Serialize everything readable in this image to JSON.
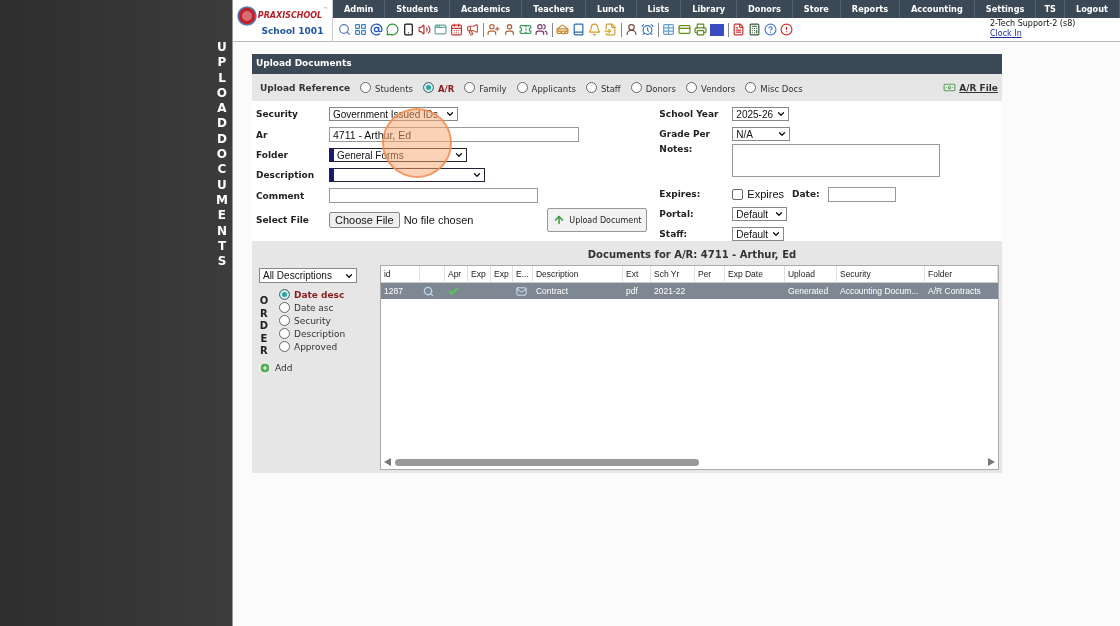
{
  "sidebar_title": "UPLOAD DOCUMENTS",
  "logo": {
    "brand": "PRAXISCHOOL",
    "trademark": "™",
    "school": "School 1001"
  },
  "nav": [
    "Admin",
    "Students",
    "Academics",
    "Teachers",
    "Lunch",
    "Lists",
    "Library",
    "Donors",
    "Store",
    "Reports",
    "Accounting",
    "Settings",
    "TS",
    "Logout"
  ],
  "user": {
    "name": "2-Tech Support-2 (s8)",
    "clock_link": "Clock In"
  },
  "panel": {
    "title": "Upload Documents",
    "reference_label": "Upload Reference",
    "references": [
      {
        "label": "Students",
        "selected": false
      },
      {
        "label": "A/R",
        "selected": true
      },
      {
        "label": "Family",
        "selected": false
      },
      {
        "label": "Applicants",
        "selected": false
      },
      {
        "label": "Staff",
        "selected": false
      },
      {
        "label": "Donors",
        "selected": false
      },
      {
        "label": "Vendors",
        "selected": false
      },
      {
        "label": "Misc Docs",
        "selected": false
      }
    ],
    "ar_file_link": "A/R File"
  },
  "left_fields": [
    {
      "kind": "select",
      "label": "Security",
      "value": "Government Issued IDs",
      "marked": false
    },
    {
      "kind": "input",
      "label": "Ar",
      "value": "4711 - Arthur, Ed"
    },
    {
      "kind": "select",
      "label": "Folder",
      "value": "General Forms",
      "marked": true
    },
    {
      "kind": "select",
      "label": "Description",
      "marked": true
    },
    {
      "kind": "input",
      "label": "Comment"
    },
    {
      "kind": "file",
      "label": "Select File",
      "button": "Choose File",
      "status": "No file chosen",
      "upload_button": "Upload Document"
    }
  ],
  "right_fields": [
    {
      "kind": "select",
      "label": "School Year",
      "value": "2025-26",
      "marked": false
    },
    {
      "kind": "select",
      "label": "Grade Per",
      "value": "N/A",
      "marked": false
    },
    {
      "kind": "textarea",
      "label": "Notes:"
    },
    {
      "kind": "expires",
      "label": "Expires:",
      "checkbox_label": "Expires",
      "checked": false,
      "date_label": "Date:"
    },
    {
      "kind": "select",
      "label": "Portal:",
      "value": "Default",
      "marked": false
    },
    {
      "kind": "select",
      "label": "Staff:",
      "value": "Default",
      "marked": false
    }
  ],
  "documents": {
    "title": "Documents for A/R: 4711 - Arthur, Ed",
    "filter": "All Descriptions",
    "order_label": "ORDER",
    "order_options": [
      {
        "label": "Date desc",
        "selected": true
      },
      {
        "label": "Date asc",
        "selected": false
      },
      {
        "label": "Security",
        "selected": false
      },
      {
        "label": "Description",
        "selected": false
      },
      {
        "label": "Approved",
        "selected": false
      }
    ],
    "add": "Add",
    "columns": [
      {
        "kind": "text",
        "label": "id"
      },
      {
        "kind": "blank"
      },
      {
        "kind": "text",
        "label": "Apr"
      },
      {
        "kind": "text",
        "label": "Exp"
      },
      {
        "kind": "text",
        "label": "Exp"
      },
      {
        "kind": "text",
        "label": "E..."
      },
      {
        "kind": "text",
        "label": "Description"
      },
      {
        "kind": "text",
        "label": "Ext"
      },
      {
        "kind": "text",
        "label": "Sch Yr"
      },
      {
        "kind": "text",
        "label": "Per"
      },
      {
        "kind": "text",
        "label": "Exp Date"
      },
      {
        "kind": "text",
        "label": "Upload"
      },
      {
        "kind": "text",
        "label": "Security"
      },
      {
        "kind": "text",
        "label": "Folder"
      }
    ],
    "rows": [
      {
        "selected": true,
        "approved": true,
        "emailed": true,
        "id": "1287",
        "description": "Contract",
        "ext": "pdf",
        "school_year": "2021-22",
        "upload": "Generated",
        "security": "Accounting Docum...",
        "folder": "A/R Contracts"
      }
    ]
  }
}
